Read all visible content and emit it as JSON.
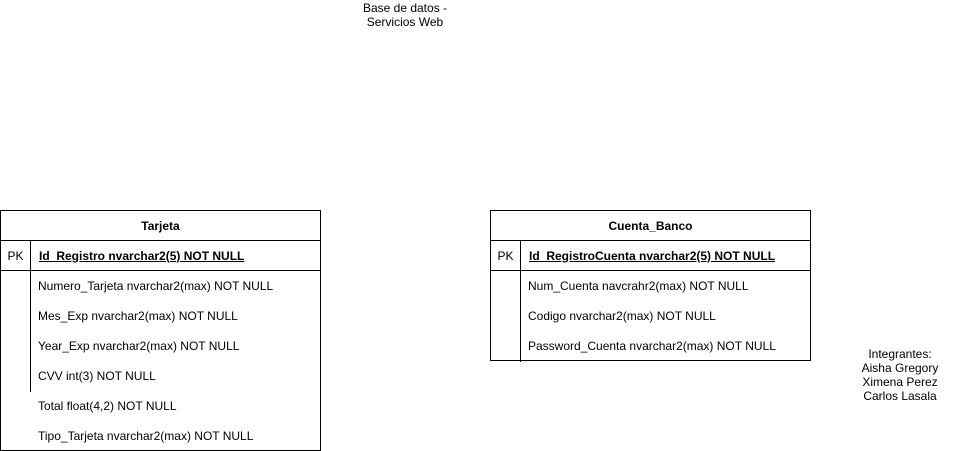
{
  "title": {
    "line1": "Base de datos -",
    "line2": "Servicios Web"
  },
  "tables": [
    {
      "name": "Tarjeta",
      "pk_label": "PK",
      "pk_field": "Id_Registro nvarchar2(5) NOT NULL",
      "fields": [
        "Numero_Tarjeta nvarchar2(max) NOT NULL",
        "Mes_Exp nvarchar2(max) NOT NULL",
        "Year_Exp nvarchar2(max) NOT NULL",
        "CVV int(3) NOT NULL",
        "Total float(4,2) NOT NULL",
        "Tipo_Tarjeta nvarchar2(max) NOT NULL"
      ]
    },
    {
      "name": "Cuenta_Banco",
      "pk_label": "PK",
      "pk_field": "Id_RegistroCuenta nvarchar2(5) NOT NULL",
      "fields": [
        "Num_Cuenta navcrahr2(max) NOT NULL",
        "Codigo nvarchar2(max) NOT NULL",
        "Password_Cuenta nvarchar2(max) NOT NULL"
      ]
    }
  ],
  "members": {
    "heading": "Integrantes:",
    "names": [
      "Aisha Gregory",
      "Ximena Perez",
      "Carlos Lasala"
    ]
  }
}
